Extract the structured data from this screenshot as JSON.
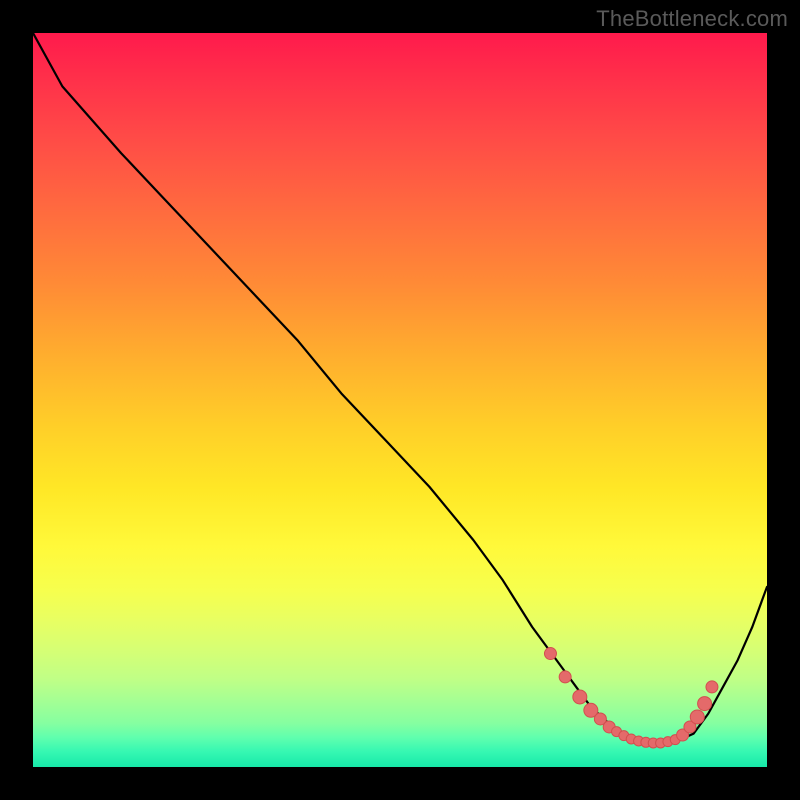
{
  "watermark": {
    "text": "TheBottleneck.com"
  },
  "colors": {
    "curve_stroke": "#000000",
    "marker_fill": "#e46a6a",
    "marker_stroke": "#d24f4f",
    "plot_border": "#000000"
  },
  "chart_data": {
    "type": "line",
    "title": "",
    "xlabel": "",
    "ylabel": "",
    "xlim": [
      0,
      100
    ],
    "ylim": [
      -5,
      105
    ],
    "grid": false,
    "legend": false,
    "series": [
      {
        "name": "curve",
        "x": [
          0,
          4,
          8,
          12,
          18,
          24,
          30,
          36,
          42,
          48,
          54,
          60,
          64,
          68,
          70,
          72,
          74,
          76,
          78,
          79,
          80,
          82,
          84,
          86,
          88,
          90,
          92,
          94,
          96,
          98,
          100
        ],
        "y": [
          105,
          97,
          92,
          87,
          80,
          73,
          66,
          59,
          51,
          44,
          37,
          29,
          23,
          16,
          13,
          10,
          7,
          4,
          2,
          1,
          0,
          -1,
          -1.5,
          -1.5,
          -1,
          0,
          3,
          7,
          11,
          16,
          22
        ]
      }
    ],
    "markers": [
      {
        "x": 70.5,
        "y": 12,
        "r": 6
      },
      {
        "x": 72.5,
        "y": 8.5,
        "r": 6
      },
      {
        "x": 74.5,
        "y": 5.5,
        "r": 7
      },
      {
        "x": 76.0,
        "y": 3.5,
        "r": 7
      },
      {
        "x": 77.3,
        "y": 2.2,
        "r": 6
      },
      {
        "x": 78.5,
        "y": 1.0,
        "r": 6
      },
      {
        "x": 79.5,
        "y": 0.3,
        "r": 5
      },
      {
        "x": 80.5,
        "y": -0.3,
        "r": 5
      },
      {
        "x": 81.5,
        "y": -0.8,
        "r": 5
      },
      {
        "x": 82.5,
        "y": -1.1,
        "r": 5
      },
      {
        "x": 83.5,
        "y": -1.3,
        "r": 5
      },
      {
        "x": 84.5,
        "y": -1.4,
        "r": 5
      },
      {
        "x": 85.5,
        "y": -1.4,
        "r": 5
      },
      {
        "x": 86.5,
        "y": -1.2,
        "r": 5
      },
      {
        "x": 87.5,
        "y": -0.9,
        "r": 5
      },
      {
        "x": 88.5,
        "y": -0.2,
        "r": 6
      },
      {
        "x": 89.5,
        "y": 1.0,
        "r": 6
      },
      {
        "x": 90.5,
        "y": 2.5,
        "r": 7
      },
      {
        "x": 91.5,
        "y": 4.5,
        "r": 7
      },
      {
        "x": 92.5,
        "y": 7.0,
        "r": 6
      }
    ]
  }
}
